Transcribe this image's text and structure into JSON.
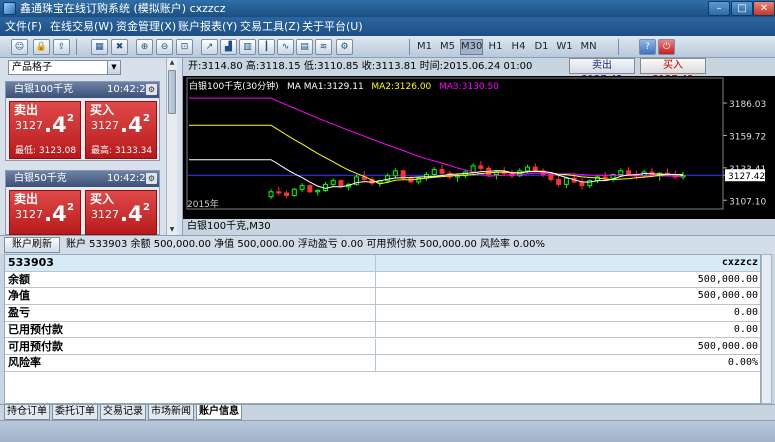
{
  "window": {
    "title": "鑫通珠宝在线订购系统 (模拟账户) cxzzcz",
    "min": "–",
    "max": "□",
    "close": "✕"
  },
  "menu": [
    "文件(F)",
    "在线交易(W)",
    "资金管理(X)",
    "账户报表(Y)",
    "交易工具(Z)",
    "关于平台(U)"
  ],
  "toolbar": {
    "icons": [
      "user-icon",
      "lock-icon",
      "export-icon",
      "grid-icon",
      "delete-icon",
      "zoom-in-icon",
      "zoom-out-icon",
      "fit-icon",
      "chart-line-icon",
      "chart-area-icon",
      "chart-bar-icon",
      "chart-candle-icon",
      "chart-ma-icon",
      "chart-volume-icon",
      "chart-indicator-icon",
      "settings-icon"
    ],
    "icon_glyphs": [
      "☺",
      "🔒",
      "⇪",
      "▦",
      "✖",
      "⊕",
      "⊖",
      "⊡",
      "↗",
      "▟",
      "▥",
      "┃",
      "∿",
      "▤",
      "≋",
      "⚙"
    ],
    "periods": [
      "M1",
      "M5",
      "M30",
      "H1",
      "H4",
      "D1",
      "W1",
      "MN"
    ],
    "active_period": "M30",
    "help_glyph": "?",
    "power_glyph": "⏻"
  },
  "product_select": {
    "label": "产品格子"
  },
  "cards": [
    {
      "name": "白银100千克",
      "time": "10:42:20",
      "sell_label": "卖出",
      "buy_label": "买入",
      "price_prefix": "3127",
      "big": ".4",
      "sup": "2",
      "low_label": "最低:",
      "low": "3123.08",
      "high_label": "最高:",
      "high": "3133.34"
    },
    {
      "name": "白银50千克",
      "time": "10:42:20",
      "sell_label": "卖出",
      "buy_label": "买入",
      "price_prefix": "3127",
      "big": ".4",
      "sup": "2"
    }
  ],
  "quote_bar": {
    "open_label": "开:",
    "open": "3114.80",
    "high_label": "高:",
    "high": "3118.15",
    "low_label": "低:",
    "low": "3110.85",
    "close_label": "收:",
    "close": "3113.81",
    "time_label": "时间:",
    "time": "2015.06.24 01:00",
    "sell_btn": "卖出 3127.42",
    "buy_btn": "买入 3127.42"
  },
  "chart_data": {
    "type": "candlestick",
    "title": "白银100千克(30分钟)",
    "ma_labels": [
      {
        "text": "MA MA1:3129.11",
        "color": "#ffffff"
      },
      {
        "text": "MA2:3126.00",
        "color": "#ffff00"
      },
      {
        "text": "MA3:3130.50",
        "color": "#ff00ff"
      }
    ],
    "y_ticks": [
      "3186.03",
      "3159.72",
      "3133.41",
      "3127.42",
      "3107.10"
    ],
    "y_tick_values": [
      3186.03,
      3159.72,
      3133.41,
      3127.42,
      3107.1
    ],
    "current_price": 3127.42,
    "ylim": [
      3100,
      3195
    ],
    "x_label": "2015年",
    "candles": [
      [
        3110,
        3116,
        3108,
        3114
      ],
      [
        3114,
        3118,
        3111,
        3113
      ],
      [
        3113,
        3115,
        3109,
        3111
      ],
      [
        3111,
        3117,
        3110,
        3116
      ],
      [
        3116,
        3121,
        3114,
        3119
      ],
      [
        3119,
        3120,
        3113,
        3114
      ],
      [
        3114,
        3116,
        3111,
        3115
      ],
      [
        3115,
        3122,
        3114,
        3120
      ],
      [
        3120,
        3125,
        3118,
        3123
      ],
      [
        3123,
        3124,
        3117,
        3118
      ],
      [
        3118,
        3121,
        3115,
        3120
      ],
      [
        3120,
        3128,
        3119,
        3126
      ],
      [
        3126,
        3131,
        3123,
        3124
      ],
      [
        3124,
        3126,
        3119,
        3121
      ],
      [
        3121,
        3124,
        3118,
        3123
      ],
      [
        3123,
        3129,
        3121,
        3127
      ],
      [
        3127,
        3133,
        3125,
        3131
      ],
      [
        3131,
        3132,
        3124,
        3125
      ],
      [
        3125,
        3127,
        3121,
        3122
      ],
      [
        3122,
        3126,
        3120,
        3125
      ],
      [
        3125,
        3130,
        3123,
        3128
      ],
      [
        3128,
        3134,
        3126,
        3132
      ],
      [
        3132,
        3136,
        3128,
        3129
      ],
      [
        3129,
        3131,
        3124,
        3126
      ],
      [
        3126,
        3129,
        3122,
        3127
      ],
      [
        3127,
        3132,
        3125,
        3130
      ],
      [
        3130,
        3137,
        3128,
        3135
      ],
      [
        3135,
        3139,
        3131,
        3133
      ],
      [
        3133,
        3135,
        3127,
        3128
      ],
      [
        3128,
        3131,
        3124,
        3130
      ],
      [
        3130,
        3134,
        3127,
        3129
      ],
      [
        3129,
        3132,
        3125,
        3127
      ],
      [
        3127,
        3133,
        3126,
        3131
      ],
      [
        3131,
        3136,
        3129,
        3134
      ],
      [
        3134,
        3137,
        3130,
        3131
      ],
      [
        3131,
        3133,
        3126,
        3128
      ],
      [
        3128,
        3130,
        3122,
        3124
      ],
      [
        3124,
        3127,
        3118,
        3120
      ],
      [
        3120,
        3126,
        3117,
        3125
      ],
      [
        3125,
        3129,
        3121,
        3122
      ],
      [
        3122,
        3125,
        3116,
        3119
      ],
      [
        3119,
        3124,
        3117,
        3123
      ],
      [
        3123,
        3128,
        3121,
        3126
      ],
      [
        3126,
        3130,
        3123,
        3125
      ],
      [
        3125,
        3129,
        3122,
        3128
      ],
      [
        3128,
        3133,
        3126,
        3131
      ],
      [
        3131,
        3134,
        3127,
        3128
      ],
      [
        3128,
        3131,
        3124,
        3127
      ],
      [
        3127,
        3132,
        3125,
        3130
      ],
      [
        3130,
        3133,
        3126,
        3127
      ],
      [
        3127,
        3130,
        3123,
        3129
      ],
      [
        3129,
        3133,
        3127,
        3128
      ],
      [
        3128,
        3131,
        3124,
        3126
      ],
      [
        3126,
        3130,
        3124,
        3127
      ]
    ],
    "footer": "白银100千克,M30"
  },
  "account_bar": {
    "refresh": "账户刷新",
    "summary": "账户 533903   余额 500,000.00   净值 500,000.00   浮动盈亏 0.00   可用预付款 500,000.00   风险率 0.00%"
  },
  "account_grid": {
    "head": {
      "left": "533903",
      "right": "cxzzcz"
    },
    "rows": [
      {
        "label": "余额",
        "value": "500,000.00"
      },
      {
        "label": "净值",
        "value": "500,000.00"
      },
      {
        "label": "盈亏",
        "value": "0.00"
      },
      {
        "label": "已用预付款",
        "value": "0.00"
      },
      {
        "label": "可用预付款",
        "value": "500,000.00"
      },
      {
        "label": "风险率",
        "value": "0.00%"
      }
    ]
  },
  "tabs": [
    "持仓订单",
    "委托订单",
    "交易记录",
    "市场新闻",
    "账户信息"
  ],
  "active_tab": "账户信息",
  "colors": {
    "sell": "#c62020",
    "chart_bg": "#000000",
    "bull": "#00ff00",
    "bear": "#ff3030",
    "ma1": "#ffffff",
    "ma2": "#ffff00",
    "ma3": "#ff00ff"
  }
}
